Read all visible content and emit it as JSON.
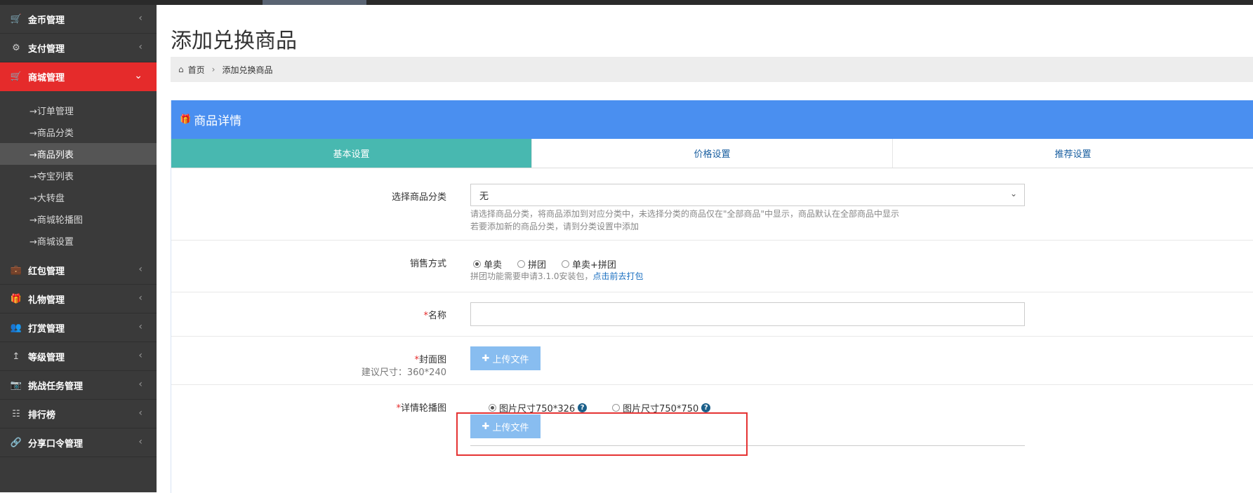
{
  "sidebar": {
    "items": [
      {
        "icon": "cart-icon",
        "label": "金币管理"
      },
      {
        "icon": "gears-icon",
        "label": "支付管理"
      },
      {
        "icon": "cart-icon",
        "label": "商城管理"
      },
      {
        "icon": "briefcase-icon",
        "label": "红包管理"
      },
      {
        "icon": "gift-icon",
        "label": "礼物管理"
      },
      {
        "icon": "users-icon",
        "label": "打赏管理"
      },
      {
        "icon": "level-up-icon",
        "label": "等级管理"
      },
      {
        "icon": "camera-icon",
        "label": "挑战任务管理"
      },
      {
        "icon": "sitemap-icon",
        "label": "排行榜"
      },
      {
        "icon": "link-icon",
        "label": "分享口令管理"
      }
    ],
    "submenu": [
      "→订单管理",
      "→商品分类",
      "→商品列表",
      "→夺宝列表",
      "→大转盘",
      "→商城轮播图",
      "→商城设置"
    ]
  },
  "page": {
    "title": "添加兑换商品",
    "breadcrumb": {
      "home": "首页",
      "current": "添加兑换商品"
    }
  },
  "panel": {
    "title": "商品详情",
    "tabs": [
      "基本设置",
      "价格设置",
      "推荐设置"
    ]
  },
  "form": {
    "category": {
      "label": "选择商品分类",
      "value": "无",
      "help1": "请选择商品分类，将商品添加到对应分类中，未选择分类的商品仅在\"全部商品\"中显示，商品默认在全部商品中显示",
      "help2": "若要添加新的商品分类，请到分类设置中添加"
    },
    "sale_mode": {
      "label": "销售方式",
      "options": [
        "单卖",
        "拼团",
        "单卖+拼团"
      ],
      "help": "拼团功能需要申请3.1.0安装包，",
      "help_link": "点击前去打包"
    },
    "name": {
      "required": "*",
      "label": "名称",
      "value": ""
    },
    "cover": {
      "required": "*",
      "label": "封面图",
      "size_hint": "建议尺寸：360*240",
      "upload_label": "上传文件"
    },
    "carousel": {
      "required": "*",
      "label": "详情轮播图",
      "options": [
        "图片尺寸750*326",
        "图片尺寸750*750"
      ],
      "q": "?",
      "upload_label": "上传文件"
    }
  }
}
